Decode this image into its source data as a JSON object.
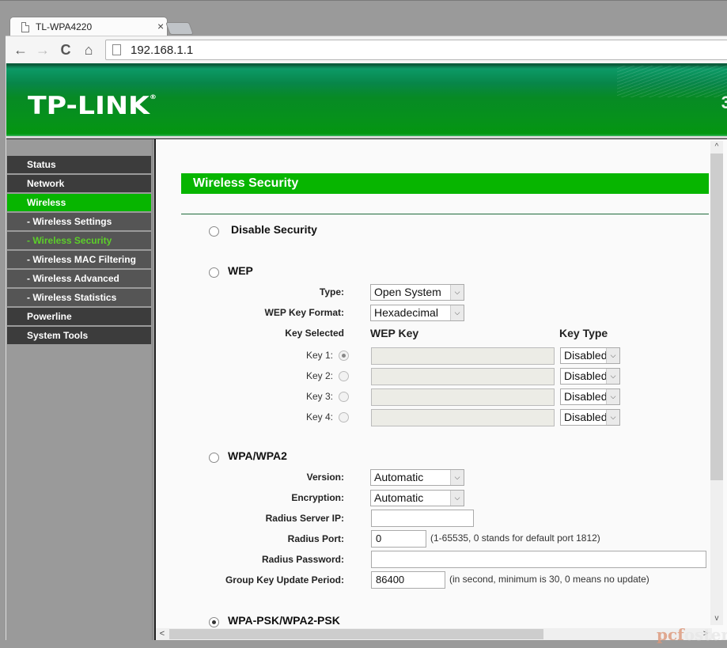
{
  "browser": {
    "tab_title": "TL-WPA4220",
    "tab_close": "×",
    "address": "192.168.1.1",
    "nav": {
      "back": "←",
      "forward": "→",
      "reload": "C",
      "home": "⌂"
    }
  },
  "banner": {
    "logo": "TP-LINK",
    "logo_mark": "®",
    "right_text": "3"
  },
  "sidebar": {
    "items": [
      {
        "label": "Status",
        "type": "main"
      },
      {
        "label": "Network",
        "type": "main"
      },
      {
        "label": "Wireless",
        "type": "main",
        "active": true
      },
      {
        "label": "- Wireless Settings",
        "type": "sub"
      },
      {
        "label": "- Wireless Security",
        "type": "sub",
        "current": true
      },
      {
        "label": "- Wireless MAC Filtering",
        "type": "sub"
      },
      {
        "label": "- Wireless Advanced",
        "type": "sub"
      },
      {
        "label": "- Wireless Statistics",
        "type": "sub"
      },
      {
        "label": "Powerline",
        "type": "main"
      },
      {
        "label": "System Tools",
        "type": "main"
      }
    ]
  },
  "page": {
    "title": "Wireless Security",
    "disable": {
      "label": "Disable Security",
      "selected": false
    },
    "wep": {
      "label": "WEP",
      "selected": false,
      "type_label": "Type:",
      "type_value": "Open System",
      "format_label": "WEP Key Format:",
      "format_value": "Hexadecimal",
      "col_key_selected": "Key Selected",
      "col_wep_key": "WEP Key",
      "col_key_type": "Key Type",
      "keys": [
        {
          "label": "Key 1:",
          "selected": true,
          "value": "",
          "type": "Disabled"
        },
        {
          "label": "Key 2:",
          "selected": false,
          "value": "",
          "type": "Disabled"
        },
        {
          "label": "Key 3:",
          "selected": false,
          "value": "",
          "type": "Disabled"
        },
        {
          "label": "Key 4:",
          "selected": false,
          "value": "",
          "type": "Disabled"
        }
      ]
    },
    "wpa": {
      "label": "WPA/WPA2",
      "selected": false,
      "version_label": "Version:",
      "version_value": "Automatic",
      "encryption_label": "Encryption:",
      "encryption_value": "Automatic",
      "radius_ip_label": "Radius Server IP:",
      "radius_ip_value": "",
      "radius_port_label": "Radius Port:",
      "radius_port_value": "0",
      "radius_port_hint": "(1-65535, 0 stands for default port 1812)",
      "radius_password_label": "Radius Password:",
      "radius_password_value": "",
      "group_key_label": "Group Key Update Period:",
      "group_key_value": "86400",
      "group_key_hint": "(in second, minimum is 30, 0 means no update)"
    },
    "wpa_psk": {
      "label": "WPA-PSK/WPA2-PSK",
      "selected": true
    }
  },
  "scroll": {
    "up": "^",
    "down": "v",
    "left": "<",
    "right": ">"
  },
  "watermark": {
    "part1": "pcf",
    "part2": "oster"
  }
}
